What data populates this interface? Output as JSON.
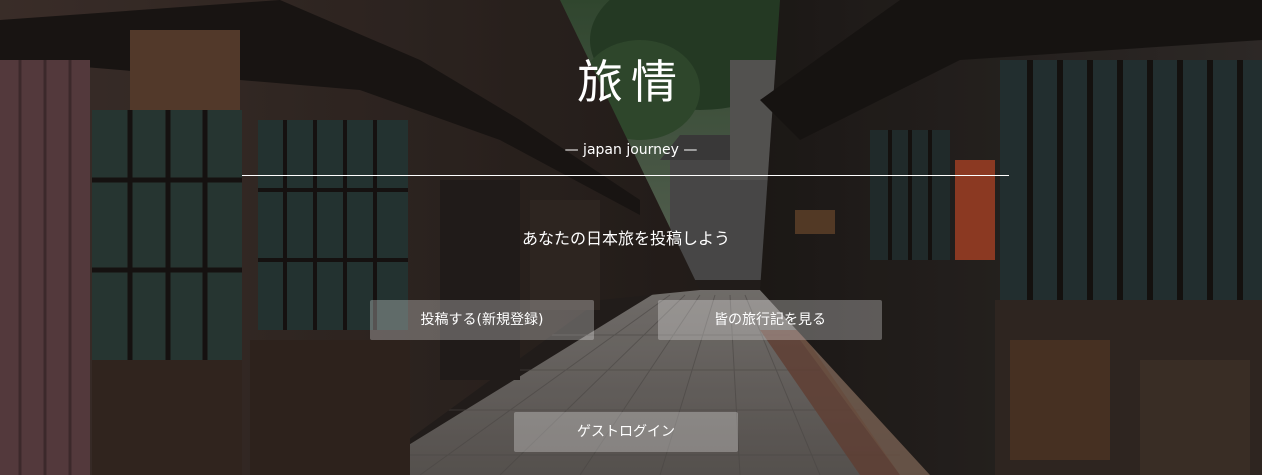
{
  "hero": {
    "title": "旅情",
    "subtitle": "— japan journey —",
    "tagline": "あなたの日本旅を投稿しよう"
  },
  "buttons": {
    "register": "投稿する(新規登録)",
    "journals": "皆の旅行記を見る",
    "guest": "ゲストログイン"
  },
  "colors": {
    "text": "#ffffff",
    "button_bg": "rgba(255,255,255,0.28)"
  }
}
